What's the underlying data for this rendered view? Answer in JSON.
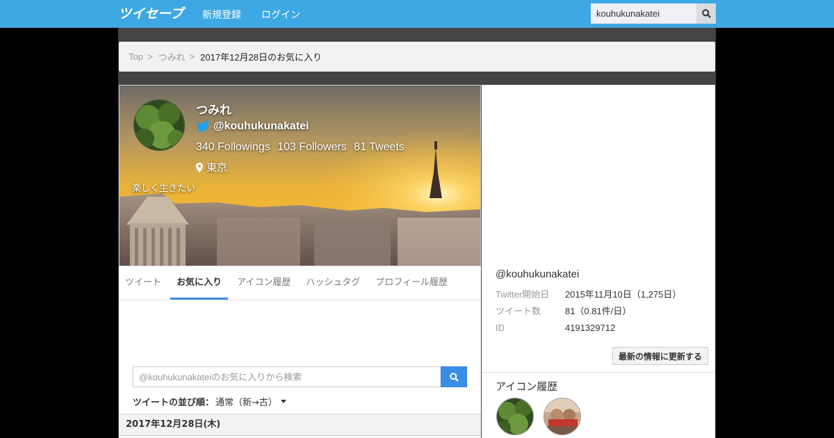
{
  "header": {
    "logo_text": "ツイセーブ",
    "nav": {
      "register": "新規登録",
      "login": "ログイン"
    },
    "search": {
      "value": "kouhukunakatei"
    }
  },
  "breadcrumb": {
    "items": [
      "Top",
      "つみれ"
    ],
    "separator": ">",
    "current": "2017年12月28日のお気に入り"
  },
  "profile": {
    "name": "つみれ",
    "handle": "@kouhukunakatei",
    "followings": "340 Followings",
    "followers": "103 Followers",
    "tweets": "81 Tweets",
    "location": "東京",
    "bio": "楽しく生きたい"
  },
  "tabs": [
    {
      "label": "ツイート",
      "active": false
    },
    {
      "label": "お気に入り",
      "active": true
    },
    {
      "label": "アイコン履歴",
      "active": false
    },
    {
      "label": "ハッシュタグ",
      "active": false
    },
    {
      "label": "プロフィール履歴",
      "active": false
    }
  ],
  "favorites": {
    "search_placeholder": "@kouhukunakateiのお気に入りから検索",
    "sort_label": "ツイートの並び順：",
    "sort_value": "通常（新→古）",
    "date_heading": "2017年12月28日(木)"
  },
  "sidebar": {
    "handle": "@kouhukunakatei",
    "info": [
      {
        "key": "Twitter開始日",
        "value": "2015年11月10日（1,275日）"
      },
      {
        "key": "ツイート数",
        "value": "81（0.81件/日）"
      },
      {
        "key": "ID",
        "value": "4191329712"
      }
    ],
    "update_button": "最新の情報に更新する",
    "icon_history_title": "アイコン履歴"
  },
  "colors": {
    "topbar": "#3ea8e5",
    "accent": "#4189dd",
    "search_button": "#3a8ee6"
  },
  "icons": [
    "search-icon",
    "twitter-bird-icon",
    "map-pin-icon",
    "caret-down-icon"
  ]
}
